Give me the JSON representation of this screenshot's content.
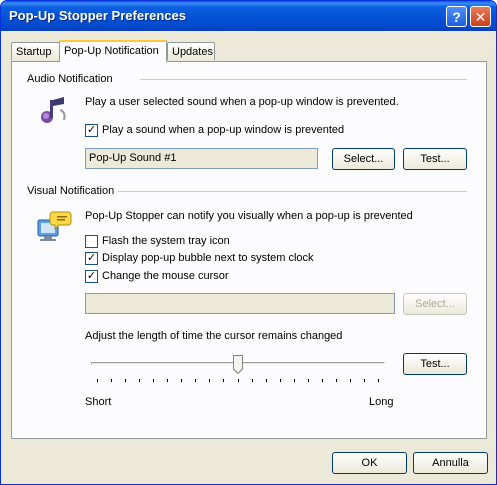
{
  "window": {
    "title": "Pop-Up Stopper Preferences",
    "help_glyph": "?",
    "close_glyph": "✕"
  },
  "tabs": [
    {
      "label": "Startup"
    },
    {
      "label": "Pop-Up Notification"
    },
    {
      "label": "Updates"
    }
  ],
  "audio": {
    "group_label": "Audio Notification",
    "description": "Play a user selected sound when a pop-up window is prevented.",
    "checkbox_label": "Play a sound when a pop-up window is prevented",
    "checkbox_checked": true,
    "sound_value": "Pop-Up Sound #1",
    "select_label": "Select...",
    "test_label": "Test..."
  },
  "visual": {
    "group_label": "Visual Notification",
    "description": "Pop-Up Stopper can notify you visually when a pop-up is prevented",
    "options": [
      {
        "label": "Flash the system tray icon",
        "checked": false
      },
      {
        "label": "Display pop-up bubble next to system clock",
        "checked": true
      },
      {
        "label": "Change the mouse cursor",
        "checked": true
      }
    ],
    "cursor_value": "",
    "select_label": "Select...",
    "adjust_label": "Adjust the length of time the cursor remains changed",
    "test_label": "Test...",
    "slider_min_label": "Short",
    "slider_max_label": "Long",
    "slider_level": 0.5
  },
  "footer": {
    "ok_label": "OK",
    "cancel_label": "Annulla"
  }
}
